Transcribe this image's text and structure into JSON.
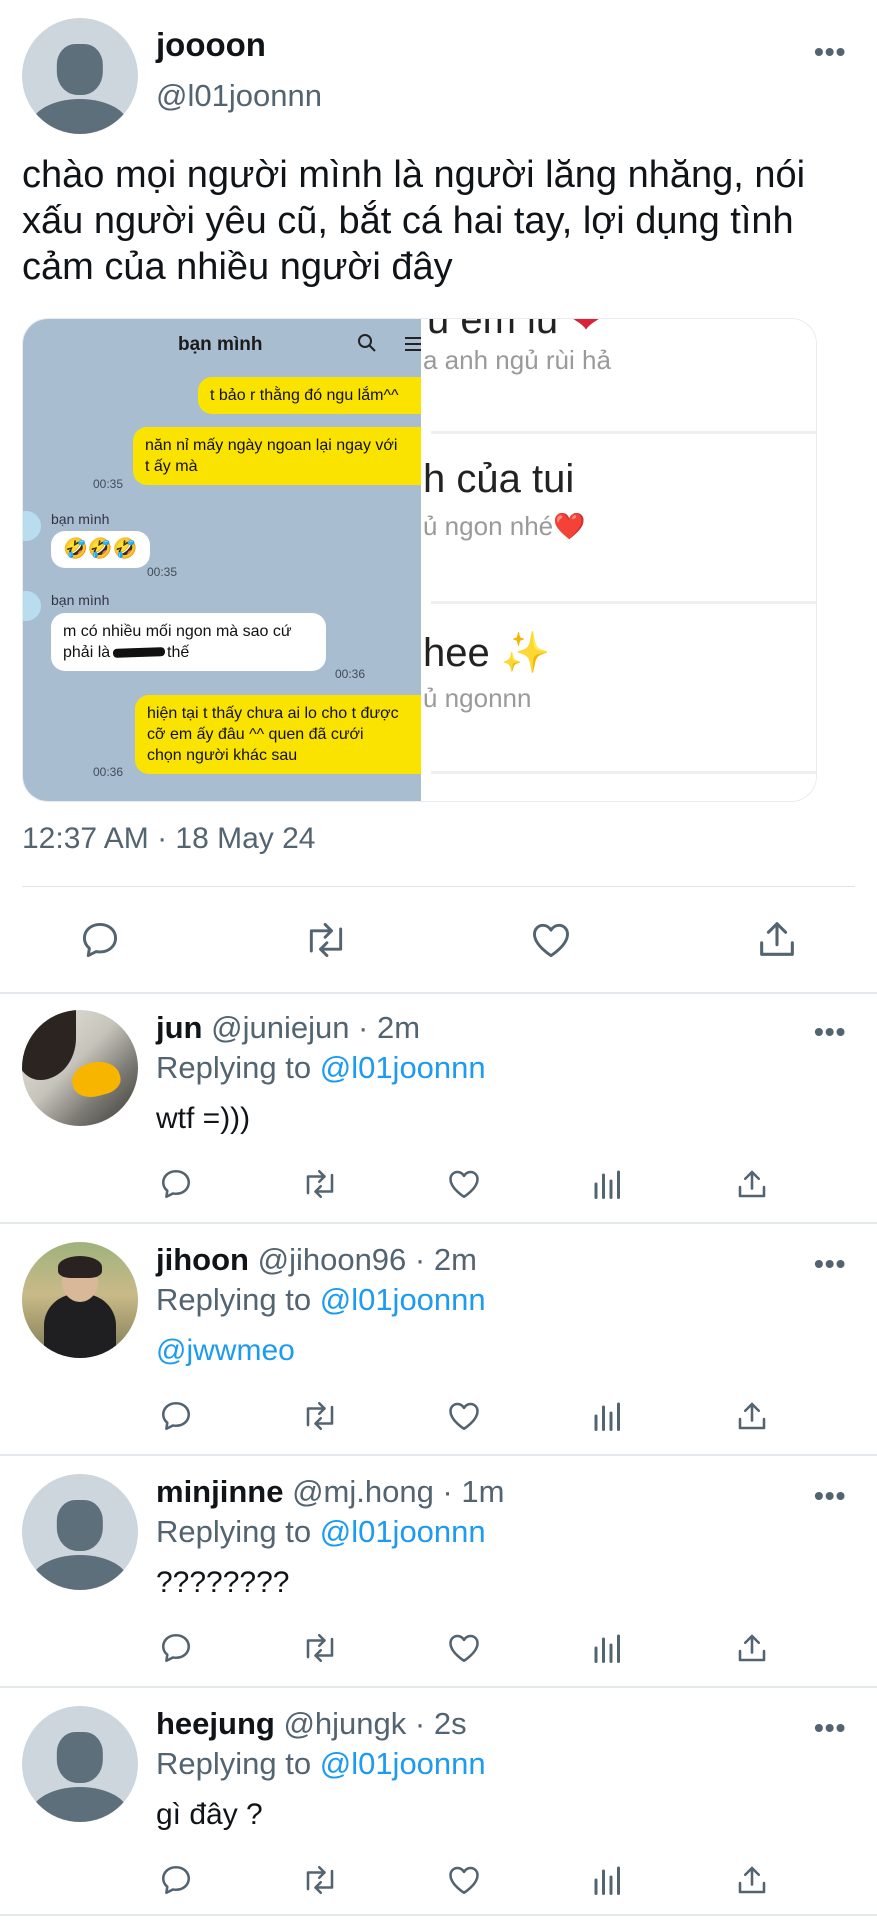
{
  "tweet": {
    "display_name": "joooon",
    "handle": "@l01joonnn",
    "text": "chào mọi người mình là người lăng nhăng, nói xấu người yêu cũ, bắt cá hai tay, lợi dụng tình cảm của nhiều người đây",
    "timestamp": "12:37 AM · 18 May 24",
    "more_icon": "more-horizontal-icon"
  },
  "media": {
    "chat": {
      "title": "bạn mình",
      "messages": [
        {
          "from": "me",
          "text": "t bảo r thằng đó ngu lắm^^",
          "time": ""
        },
        {
          "from": "me",
          "text": "năn nỉ mấy ngày ngoan lại ngay với\nt ấy mà",
          "time": "00:35"
        },
        {
          "from": "friend",
          "sender": "bạn mình",
          "text": "🤣🤣🤣",
          "time": "00:35"
        },
        {
          "from": "friend",
          "sender": "bạn mình",
          "text_before": "m có nhiều mối ngon mà sao cứ\nphải là ",
          "text_redacted": "xxxxxx",
          "text_after": " thế",
          "time": "00:36"
        },
        {
          "from": "me",
          "text": "hiện tại t thấy chưa ai lo cho t được\ncỡ em ấy đâu ^^ quen đã cưới\nchọn người khác sau",
          "time": "00:36"
        }
      ]
    },
    "notifications": [
      {
        "title": "u em iu",
        "title_emoji": "❤",
        "subtitle": "a anh ngủ rùi hả"
      },
      {
        "title": "h của tui",
        "subtitle": "ủ ngon nhé",
        "subtitle_emoji": "❤️"
      },
      {
        "title": "hee",
        "title_emoji": "✨",
        "subtitle": "ủ ngonnn"
      }
    ]
  },
  "actions": {
    "main": [
      "reply-icon",
      "retweet-icon",
      "like-icon",
      "share-icon"
    ],
    "reply": [
      "reply-icon",
      "retweet-icon",
      "like-icon",
      "views-icon",
      "share-icon"
    ]
  },
  "replies": [
    {
      "display_name": "jun",
      "meta": " @juniejun · 2m",
      "replying_label": "Replying to ",
      "mention": "@l01joonnn",
      "text": "wtf =)))",
      "text_is_link": false
    },
    {
      "display_name": "jihoon",
      "meta": " @jihoon96 · 2m",
      "replying_label": "Replying to ",
      "mention": "@l01joonnn",
      "text": "@jwwmeo",
      "text_is_link": true
    },
    {
      "display_name": "minjinne",
      "meta": " @mj.hong · 1m",
      "replying_label": "Replying to ",
      "mention": "@l01joonnn",
      "text": "????????",
      "text_is_link": false
    },
    {
      "display_name": "heejung",
      "meta": " @hjungk · 2s",
      "replying_label": "Replying to ",
      "mention": "@l01joonnn",
      "text": "gì đây ?",
      "text_is_link": false
    }
  ],
  "colors": {
    "link": "#1d9bf0",
    "secondary_text": "#536471",
    "chat_bg": "#a9bdd1",
    "chat_bubble_me": "#fbe300"
  }
}
